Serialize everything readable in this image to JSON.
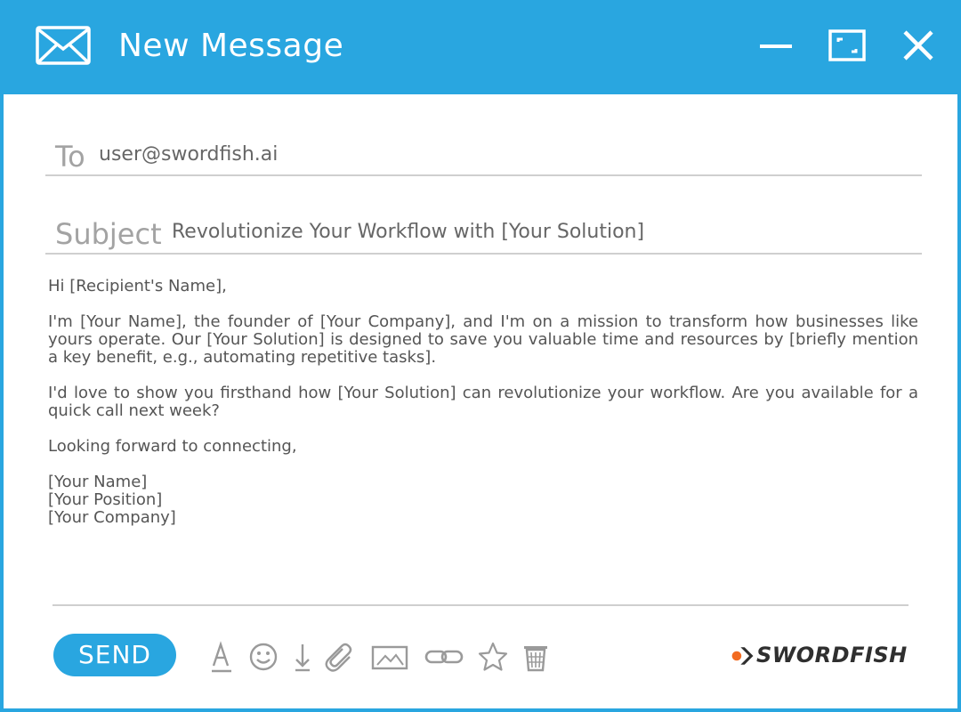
{
  "window": {
    "title": "New Message",
    "icons": [
      "envelope-icon",
      "minimize-icon",
      "maximize-icon",
      "close-icon"
    ]
  },
  "fields": {
    "to": {
      "label": "To",
      "value": "user@swordfish.ai"
    },
    "subject": {
      "label": "Subject",
      "value": "Revolutionize Your Workflow with [Your Solution]"
    }
  },
  "body": {
    "greeting": "Hi [Recipient's Name],",
    "paragraph1": "I'm [Your Name], the founder of [Your Company], and I'm on a mission to transform how businesses like yours operate. Our [Your Solution] is designed to save you valuable time and resources by [briefly mention a key benefit, e.g., automating repetitive tasks].",
    "paragraph2": "I'd love to show you firsthand how [Your Solution] can revolutionize your workflow. Are you available for a quick call next week?",
    "closing": "Looking forward to connecting,",
    "signature": [
      "[Your Name]",
      "[Your Position]",
      "[Your Company]"
    ]
  },
  "toolbar": {
    "send_label": "SEND",
    "tools": [
      "text-format-icon",
      "emoji-icon",
      "download-icon",
      "attachment-icon",
      "image-icon",
      "link-icon",
      "star-icon",
      "trash-icon"
    ]
  },
  "brand": {
    "name": "SWORDFISH",
    "accent": "#f26b21"
  },
  "colors": {
    "primary": "#29a6e0",
    "label": "#a3a3a3",
    "text": "#555555",
    "icon": "#9a9a9a"
  }
}
